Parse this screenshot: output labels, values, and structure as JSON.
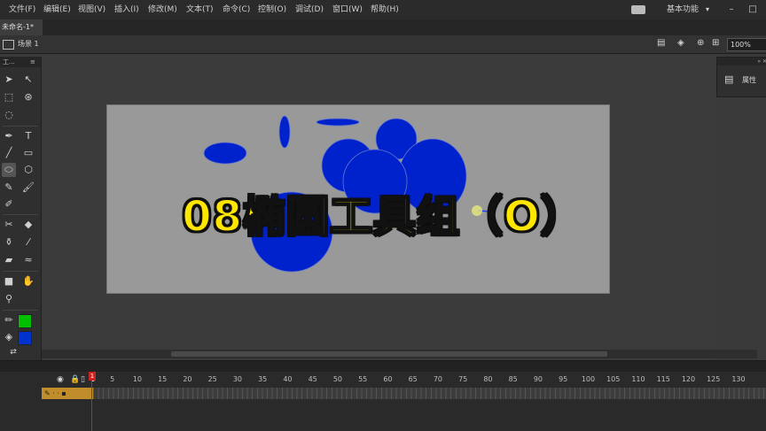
{
  "menu": {
    "items": [
      "文件(F)",
      "编辑(E)",
      "视图(V)",
      "插入(I)",
      "修改(M)",
      "文本(T)",
      "命令(C)",
      "控制(O)",
      "调试(D)",
      "窗口(W)",
      "帮助(H)"
    ],
    "workspace": "基本功能",
    "workspace_arrow": "▾",
    "minimize": "–",
    "restore": "□"
  },
  "document": {
    "tab_label": "未命名-1*",
    "tab_close": "×",
    "scene_label": "场景 1",
    "zoom": "100%"
  },
  "tools": {
    "header": "工...",
    "stroke_color": "#00c000",
    "fill_color": "#0033cc"
  },
  "properties": {
    "panel_label": "属性"
  },
  "stage": {
    "background": "#999999",
    "ellipse_color": "#0022cc"
  },
  "timeline": {
    "frame_labels": [
      "1",
      "5",
      "10",
      "15",
      "20",
      "25",
      "30",
      "35",
      "40",
      "45",
      "50",
      "55",
      "60",
      "65",
      "70",
      "75",
      "80",
      "85",
      "90",
      "95",
      "100",
      "105",
      "110",
      "115",
      "120",
      "125",
      "130"
    ],
    "current_frame": "1"
  },
  "overlay": {
    "caption": "08椭圆工具组（O）"
  }
}
